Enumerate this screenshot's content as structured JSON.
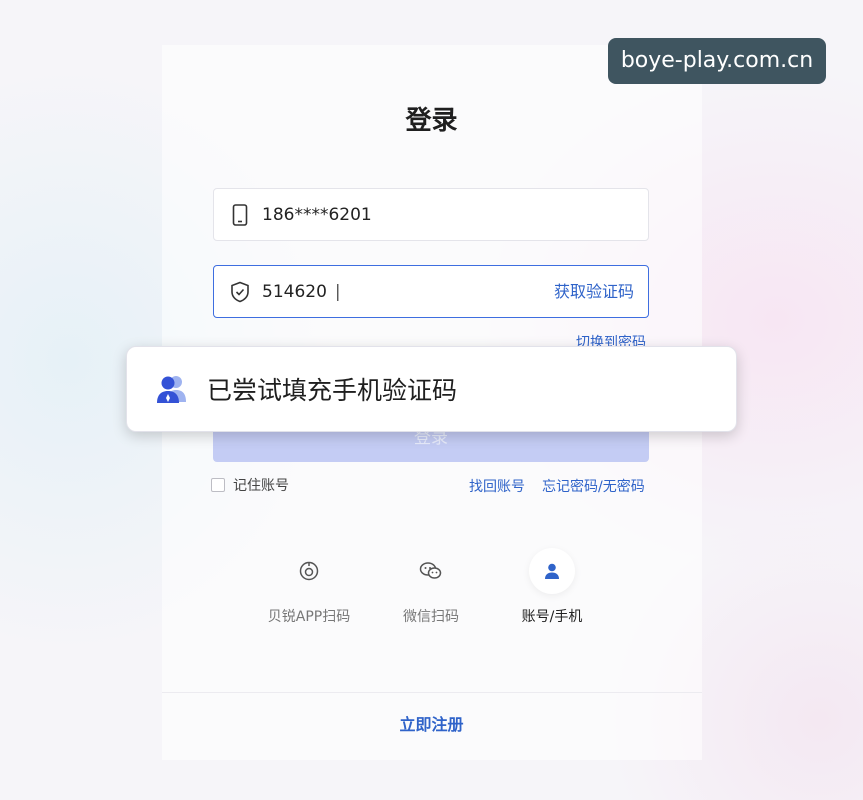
{
  "watermark": "boye-play.com.cn",
  "title": "登录",
  "phone": {
    "value": "186****6201"
  },
  "code": {
    "value": "514620",
    "caret": "|",
    "get_code": "获取验证码"
  },
  "switch_to_password": "切换到密码",
  "login_button": "登录",
  "remember": "记住账号",
  "find_account": "找回账号",
  "forgot_password": "忘记密码/无密码",
  "alt_methods": [
    {
      "label": "贝锐APP扫码",
      "icon": "scan-app-icon"
    },
    {
      "label": "微信扫码",
      "icon": "wechat-icon"
    },
    {
      "label": "账号/手机",
      "icon": "user-icon",
      "active": true
    }
  ],
  "register": "立即注册",
  "toast": {
    "text": "已尝试填充手机验证码",
    "icon": "users-icon"
  },
  "colors": {
    "accent": "#2f63c9",
    "button_disabled": "#c4ccf4",
    "watermark_bg": "#3f5560"
  }
}
